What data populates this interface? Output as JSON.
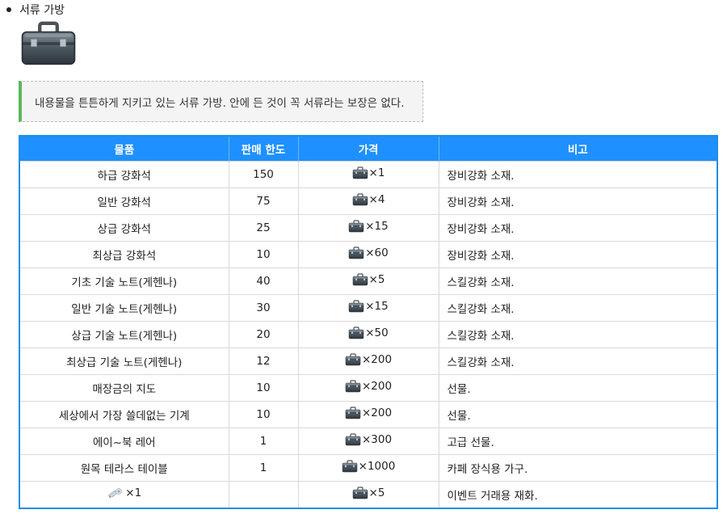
{
  "header": {
    "item_title": "서류 가방"
  },
  "notice": {
    "text": "내용물을 튼튼하게 지키고 있는 서류 가방. 안에 든 것이 꼭 서류라는 보장은 없다."
  },
  "table": {
    "headers": [
      "물품",
      "판매 한도",
      "가격",
      "비고"
    ],
    "rows": [
      {
        "item": "하급 강화석",
        "limit": "150",
        "price": "×1",
        "note": "장비강화 소재."
      },
      {
        "item": "일반 강화석",
        "limit": "75",
        "price": "×4",
        "note": "장비강화 소재."
      },
      {
        "item": "상급 강화석",
        "limit": "25",
        "price": "×15",
        "note": "장비강화 소재."
      },
      {
        "item": "최상급 강화석",
        "limit": "10",
        "price": "×60",
        "note": "장비강화 소재."
      },
      {
        "item": "기초 기술 노트(게헨나)",
        "limit": "40",
        "price": "×5",
        "note": "스킬강화 소재."
      },
      {
        "item": "일반 기술 노트(게헨나)",
        "limit": "30",
        "price": "×15",
        "note": "스킬강화 소재."
      },
      {
        "item": "상급 기술 노트(게헨나)",
        "limit": "20",
        "price": "×50",
        "note": "스킬강화 소재."
      },
      {
        "item": "최상급 기술 노트(게헨나)",
        "limit": "12",
        "price": "×200",
        "note": "스킬강화 소재."
      },
      {
        "item": "매장금의 지도",
        "limit": "10",
        "price": "×200",
        "note": "선물."
      },
      {
        "item": "세상에서 가장 쓸데없는 기계",
        "limit": "10",
        "price": "×200",
        "note": "선물."
      },
      {
        "item": "에이~북 레어",
        "limit": "1",
        "price": "×300",
        "note": "고급 선물."
      },
      {
        "item": "원목 테라스 테이블",
        "limit": "1",
        "price": "×1000",
        "note": "카페 장식용 가구."
      },
      {
        "item": "×1",
        "limit": "",
        "price": "×5",
        "note": "이벤트 거래용 재화.",
        "item_icon": "whistle-icon"
      }
    ]
  },
  "icons": {
    "currency": "briefcase-icon",
    "event_item": "whistle-icon"
  },
  "colors": {
    "header_bg": "#1e90ff",
    "notice_accent": "#5cb85c",
    "table_border": "#1e8ee9"
  }
}
